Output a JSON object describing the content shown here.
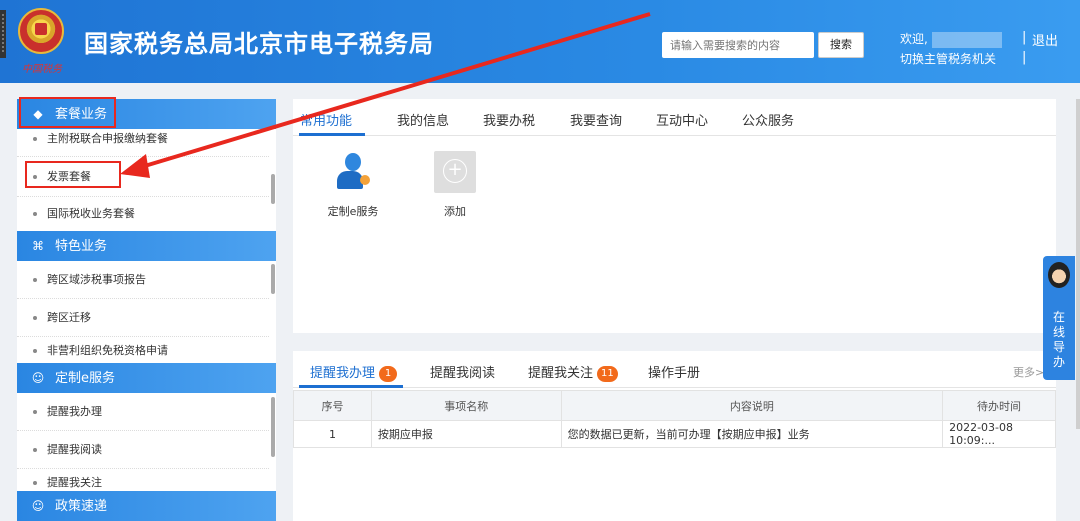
{
  "header": {
    "seal_text": "中国税务",
    "site_title": "国家税务总局北京市电子税务局",
    "search_placeholder": "请输入需要搜索的内容",
    "search_button": "搜索",
    "welcome": "欢迎,",
    "switch_org": "切换主管税务机关",
    "separator": "|",
    "logout": "退出"
  },
  "sidebar": {
    "groups": [
      {
        "label": "套餐业务",
        "icon": "package-icon"
      },
      {
        "label": "特色业务",
        "icon": "grid-icon"
      },
      {
        "label": "定制e服务",
        "icon": "user-icon"
      },
      {
        "label": "政策速递",
        "icon": "user-icon"
      }
    ],
    "package_items": [
      "主附税联合申报缴纳套餐",
      "发票套餐",
      "国际税收业务套餐"
    ],
    "special_items": [
      "跨区域涉税事项报告",
      "跨区迁移",
      "非营利组织免税资格申请"
    ],
    "custom_items": [
      "提醒我办理",
      "提醒我阅读",
      "提醒我关注"
    ]
  },
  "main_tabs": [
    "常用功能",
    "我的信息",
    "我要办税",
    "我要查询",
    "互动中心",
    "公众服务"
  ],
  "functions": [
    {
      "label": "定制e服务",
      "icon": "person-service-icon"
    },
    {
      "label": "添加",
      "icon": "add-icon"
    }
  ],
  "reminder_tabs": [
    {
      "label": "提醒我办理",
      "badge": "1"
    },
    {
      "label": "提醒我阅读",
      "badge": ""
    },
    {
      "label": "提醒我关注",
      "badge": "11"
    },
    {
      "label": "操作手册",
      "badge": ""
    }
  ],
  "more": "更多>",
  "table": {
    "headers": [
      "序号",
      "事项名称",
      "内容说明",
      "待办时间"
    ],
    "rows": [
      [
        "1",
        "按期应申报",
        "您的数据已更新，当前可办理【按期应申报】业务",
        "2022-03-08 10:09:..."
      ]
    ]
  },
  "float_help": {
    "text": "在线导办"
  },
  "colors": {
    "brand_blue": "#2a86e2",
    "highlight_red": "#e8281e",
    "badge_orange": "#f26a1b"
  }
}
